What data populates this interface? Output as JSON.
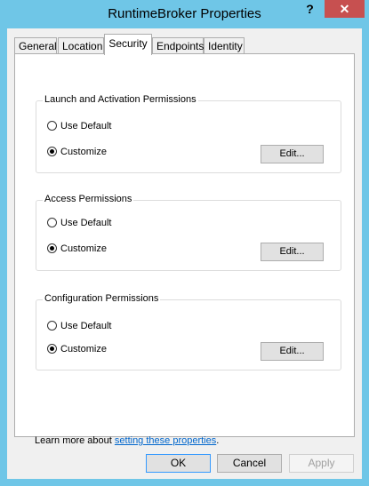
{
  "window": {
    "title": "RuntimeBroker Properties",
    "help_icon": "?",
    "close_icon": "✕"
  },
  "tabs": [
    "General",
    "Location",
    "Security",
    "Endpoints",
    "Identity"
  ],
  "active_tab": "Security",
  "groups": [
    {
      "title": "Launch and Activation Permissions",
      "use_default": "Use Default",
      "customize": "Customize",
      "selected": "Customize",
      "edit": "Edit..."
    },
    {
      "title": "Access Permissions",
      "use_default": "Use Default",
      "customize": "Customize",
      "selected": "Customize",
      "edit": "Edit..."
    },
    {
      "title": "Configuration Permissions",
      "use_default": "Use Default",
      "customize": "Customize",
      "selected": "Customize",
      "edit": "Edit..."
    }
  ],
  "learn_more": {
    "prefix": "Learn more about ",
    "link": "setting these properties",
    "suffix": "."
  },
  "buttons": {
    "ok": "OK",
    "cancel": "Cancel",
    "apply": "Apply"
  },
  "colors": {
    "title_bar": "#6fc6e7",
    "close_button": "#c75050",
    "link": "#0066cc"
  }
}
